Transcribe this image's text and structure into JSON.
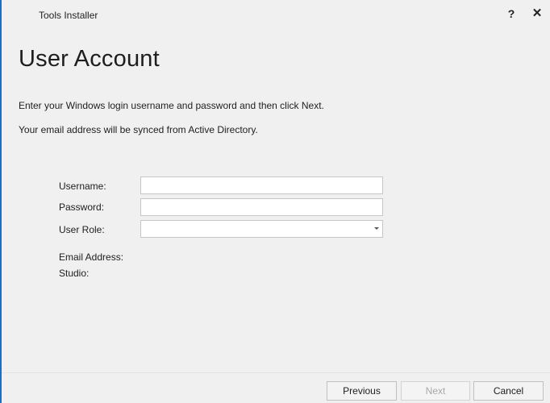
{
  "window": {
    "title": "Tools Installer",
    "help_label": "?",
    "close_label": "✕"
  },
  "page": {
    "title": "User Account",
    "instruction_1": "Enter your Windows login username and password and then click Next.",
    "instruction_2": "Your email address will be synced from Active Directory."
  },
  "form": {
    "username_label": "Username:",
    "username_value": "",
    "password_label": "Password:",
    "password_value": "",
    "role_label": "User Role:",
    "role_value": "",
    "email_label": "Email Address:",
    "studio_label": "Studio:"
  },
  "footer": {
    "previous_label": "Previous",
    "next_label": "Next",
    "cancel_label": "Cancel",
    "next_disabled": true
  },
  "colors": {
    "accent_border": "#1c6ec4",
    "window_bg": "#f0f0f0",
    "disabled_text": "#a8a8a8"
  }
}
